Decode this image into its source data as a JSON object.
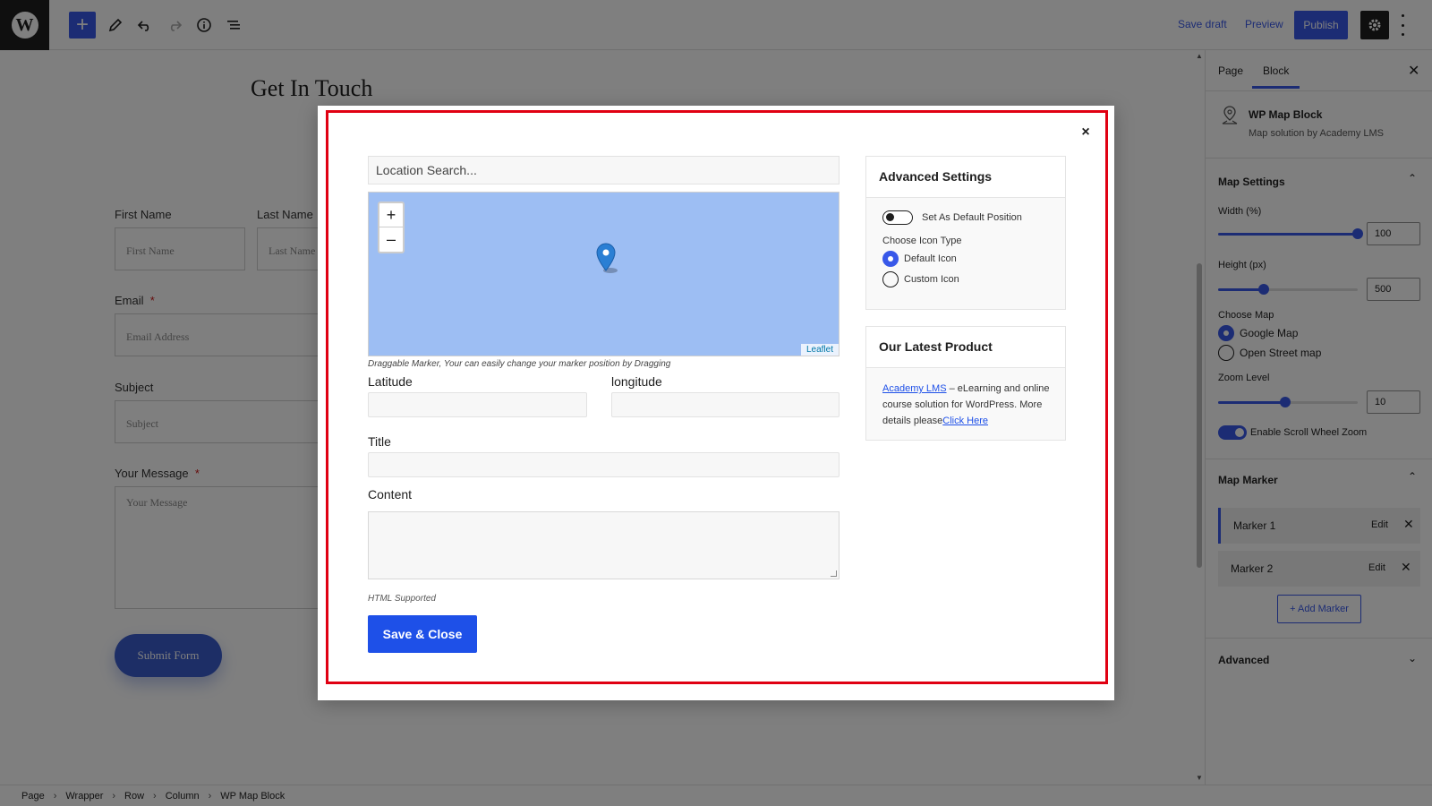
{
  "toolbar": {
    "save_draft": "Save draft",
    "preview": "Preview",
    "publish": "Publish",
    "accent_color": "#3858e9"
  },
  "canvas": {
    "page_title": "Get In Touch",
    "form": {
      "first_name_label": "First Name",
      "first_name_placeholder": "First Name",
      "last_name_label": "Last Name",
      "last_name_placeholder": "Last Name",
      "email_label": "Email",
      "email_required": "*",
      "email_placeholder": "Email Address",
      "subject_label": "Subject",
      "subject_placeholder": "Subject",
      "message_label": "Your Message",
      "message_required": "*",
      "message_placeholder": "Your Message",
      "submit_label": "Submit Form"
    }
  },
  "modal": {
    "location_search_placeholder": "Location Search...",
    "zoom_in": "+",
    "zoom_out": "–",
    "leaflet_attribution": "Leaflet",
    "map_hint": "Draggable Marker, Your can easily change your marker position by Dragging",
    "latitude_label": "Latitude",
    "longitude_label": "longitude",
    "title_label": "Title",
    "content_label": "Content",
    "html_note": "HTML Supported",
    "save_close_label": "Save & Close",
    "close_symbol": "×",
    "advanced": {
      "heading": "Advanced Settings",
      "default_position_label": "Set As Default Position",
      "default_position_on": false,
      "icon_type_label": "Choose Icon Type",
      "icon_options": [
        "Default Icon",
        "Custom Icon"
      ],
      "icon_selected": "Default Icon"
    },
    "product": {
      "heading": "Our Latest Product",
      "link_text": "Academy LMS",
      "text_middle": " – eLearning and online course solution for WordPress. More details please",
      "click_here": "Click Here"
    },
    "highlight_color": "#e00012"
  },
  "sidebar": {
    "tabs": [
      "Page",
      "Block"
    ],
    "active_tab": "Block",
    "block_name": "WP Map Block",
    "block_desc": "Map solution by Academy LMS",
    "map_settings": {
      "title": "Map Settings",
      "width_label": "Width (%)",
      "width_value": "100",
      "height_label": "Height (px)",
      "height_value": "500",
      "choose_map_label": "Choose Map",
      "map_options": [
        "Google Map",
        "Open Street map"
      ],
      "map_selected": "Google Map",
      "zoom_label": "Zoom Level",
      "zoom_value": "10",
      "scroll_zoom_label": "Enable Scroll Wheel Zoom",
      "scroll_zoom_on": true
    },
    "map_marker": {
      "title": "Map Marker",
      "markers": [
        {
          "name": "Marker 1",
          "edit": "Edit"
        },
        {
          "name": "Marker 2",
          "edit": "Edit"
        }
      ],
      "add_label": "+ Add Marker"
    },
    "advanced_title": "Advanced"
  },
  "breadcrumb": [
    "Page",
    "Wrapper",
    "Row",
    "Column",
    "WP Map Block"
  ]
}
